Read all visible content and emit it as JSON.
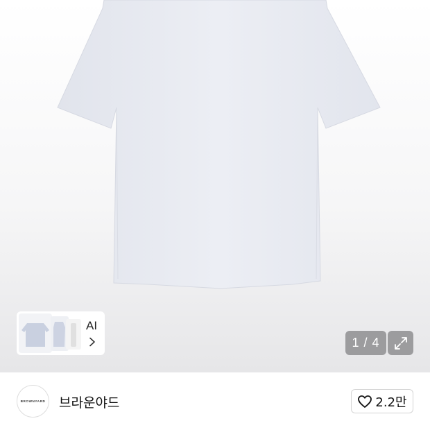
{
  "gallery": {
    "image": "white-tshirt-photo",
    "ai_card": {
      "label": "AI",
      "arrow_icon": "chevron-right-icon"
    },
    "page_counter": "1 / 4",
    "expand_icon": "expand-arrows-icon"
  },
  "brand": {
    "logo_text": "BROWNYARD",
    "name": "브라운야드",
    "like_icon": "heart-icon",
    "like_count": "2.2만"
  },
  "colors": {
    "overlay_button": "#9c9c9e",
    "shirt": "#e8eaf0"
  }
}
